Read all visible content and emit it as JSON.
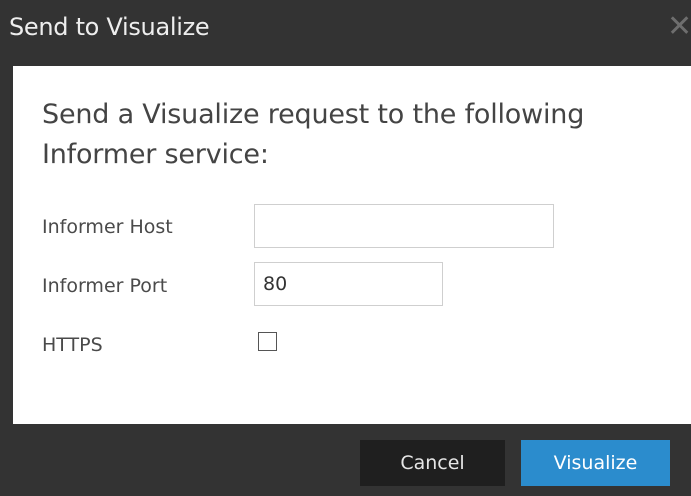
{
  "dialog": {
    "title": "Send to Visualize",
    "close_icon": "close-icon",
    "close_glyph": "✕"
  },
  "body": {
    "intro_text": "Send a Visualize request to the following Informer service:",
    "fields": {
      "host_label": "Informer Host",
      "host_value": "",
      "port_label": "Informer Port",
      "port_value": "80",
      "https_label": "HTTPS",
      "https_checked": false
    }
  },
  "footer": {
    "cancel_label": "Cancel",
    "visualize_label": "Visualize"
  },
  "colors": {
    "chrome": "#333333",
    "accent": "#2b8ccd",
    "cancel_bg": "#1f1f1f"
  }
}
